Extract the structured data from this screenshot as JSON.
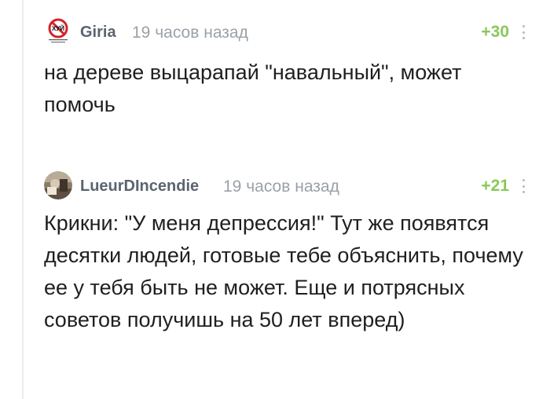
{
  "comments": [
    {
      "username": "Giria",
      "timestamp": "19 часов назад",
      "rating": "+30",
      "avatar_icon": "no-sign-avatar-icon",
      "avatar_text": "ХУЙ",
      "text": "на дереве выцарапай \"навальный\",  может помочь"
    },
    {
      "username": "LueurDIncendie",
      "timestamp": "19 часов назад",
      "rating": "+21",
      "avatar_icon": "photo-avatar-icon",
      "text": "Крикни: \"У меня депрессия!\" Тут же появятся десятки людей, готовые тебе объяснить, почему ее у тебя быть не может. Еще и потрясных советов получишь на 50 лет вперед)"
    }
  ],
  "colors": {
    "rating_green": "#8ac858",
    "username_gray": "#5a6470",
    "timestamp_gray": "#9aa1a8",
    "text": "#1f1f1f"
  }
}
